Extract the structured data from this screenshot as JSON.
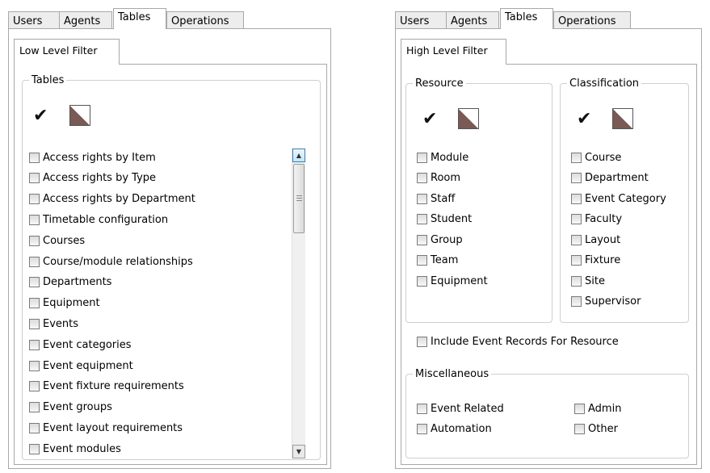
{
  "left": {
    "tabs": [
      {
        "label": "Users"
      },
      {
        "label": "Agents"
      },
      {
        "label": "Tables"
      },
      {
        "label": "Operations"
      }
    ],
    "active_tab": "Tables",
    "subtab": "Low Level Filter",
    "group_title": "Tables",
    "items": [
      "Access rights by Item",
      "Access rights by Type",
      "Access rights by Department",
      "Timetable configuration",
      "Courses",
      "Course/module relationships",
      "Departments",
      "Equipment",
      "Events",
      "Event categories",
      "Event equipment",
      "Event fixture requirements",
      "Event groups",
      "Event layout requirements",
      "Event modules"
    ],
    "scrollbar": {
      "up_glyph": "▲",
      "down_glyph": "▼"
    }
  },
  "right": {
    "tabs": [
      {
        "label": "Users"
      },
      {
        "label": "Agents"
      },
      {
        "label": "Tables"
      },
      {
        "label": "Operations"
      }
    ],
    "active_tab": "Tables",
    "subtab": "High Level Filter",
    "resource": {
      "title": "Resource",
      "items": [
        "Module",
        "Room",
        "Staff",
        "Student",
        "Group",
        "Team",
        "Equipment"
      ]
    },
    "classification": {
      "title": "Classification",
      "items": [
        "Course",
        "Department",
        "Event Category",
        "Faculty",
        "Layout",
        "Fixture",
        "Site",
        "Supervisor"
      ]
    },
    "include_event_records": "Include Event Records For Resource",
    "misc": {
      "title": "Miscellaneous",
      "items": [
        "Event Related",
        "Automation",
        "Admin",
        "Other"
      ]
    }
  },
  "icons": {
    "select_all": "checkmark-icon",
    "clear_all": "clear-selection-icon"
  },
  "colors": {
    "clear_icon": "#7a5a54",
    "border": "#a8a8a8",
    "scroll_arrow_active": "#3c7fb1"
  }
}
